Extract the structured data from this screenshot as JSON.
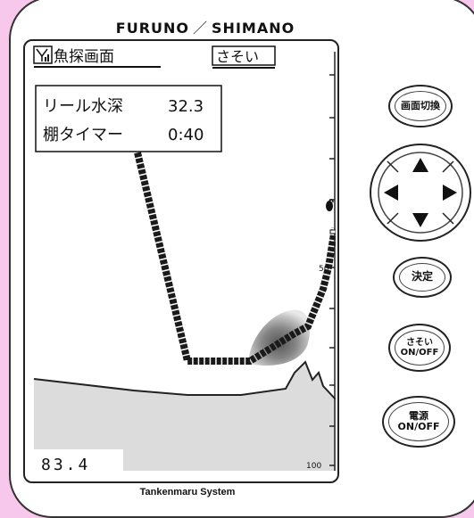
{
  "brand": {
    "left": "FURUNO",
    "right": "SHIMANO"
  },
  "footer": "Tankenmaru System",
  "screen": {
    "title": "魚探画面",
    "mode": "さそい",
    "reel_depth_label": "リール水深",
    "reel_depth_value": "32.3",
    "tana_timer_label": "棚タイマー",
    "tana_timer_value": "0:40",
    "depth_readout": "83.4",
    "scale_labels": [
      "50",
      "100"
    ]
  },
  "buttons": {
    "screen_switch": "画面切換",
    "enter": "決定",
    "sasoi_line1": "さそい",
    "sasoi_line2": "ON/OFF",
    "power_line1": "電源",
    "power_line2": "ON/OFF"
  },
  "icons": {
    "signal": "antenna-signal-icon",
    "hook": "hook-icon",
    "dpad_arrows": [
      "up-arrow-icon",
      "down-arrow-icon",
      "left-arrow-icon",
      "right-arrow-icon"
    ]
  },
  "colors": {
    "background": "#f7c8ec",
    "seabed": "#dcdcdc",
    "trace": "#1a1a1a"
  }
}
